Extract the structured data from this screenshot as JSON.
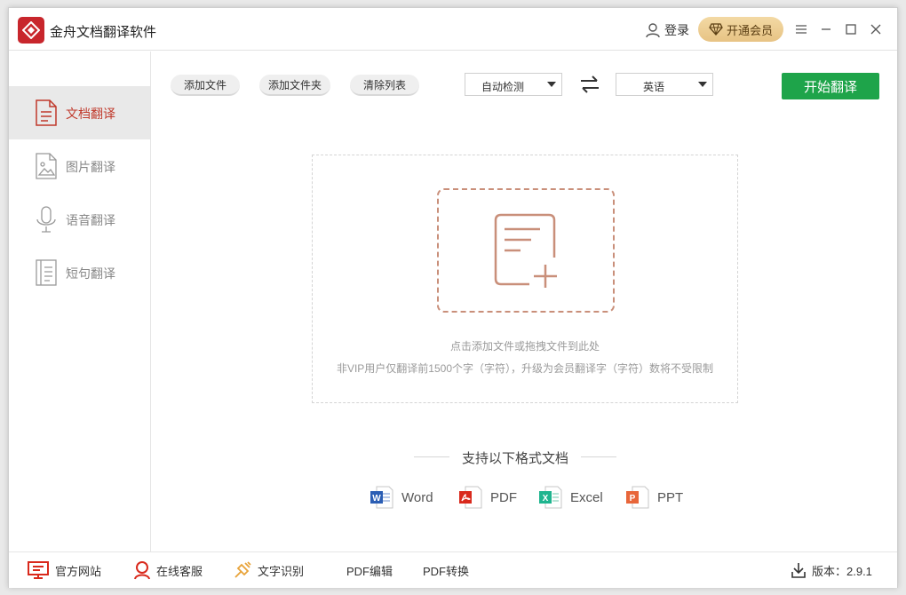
{
  "app": {
    "title": "金舟文档翻译软件",
    "login_label": "登录",
    "vip_label": "开通会员",
    "colors": {
      "brand": "#c8262c",
      "accent_green": "#1ea44a",
      "active_text": "#c0392b",
      "dash": "#c98f7a"
    }
  },
  "sidebar": {
    "items": [
      {
        "label": "文档翻译",
        "icon": "document-icon",
        "active": true
      },
      {
        "label": "图片翻译",
        "icon": "image-icon",
        "active": false
      },
      {
        "label": "语音翻译",
        "icon": "microphone-icon",
        "active": false
      },
      {
        "label": "短句翻译",
        "icon": "text-lines-icon",
        "active": false
      }
    ]
  },
  "toolbar": {
    "add_file": "添加文件",
    "add_folder": "添加文件夹",
    "clear_list": "清除列表",
    "source_lang": "自动检测",
    "target_lang": "英语",
    "start": "开始翻译"
  },
  "dropzone": {
    "hint": "点击添加文件或拖拽文件到此处",
    "note": "非VIP用户仅翻译前1500个字（字符），升级为会员翻译字（字符）数将不受限制"
  },
  "formats": {
    "title": "支持以下格式文档",
    "items": [
      {
        "name": "Word",
        "icon": "word-icon",
        "color": "#2b5eb4"
      },
      {
        "name": "PDF",
        "icon": "pdf-icon",
        "color": "#d9291c"
      },
      {
        "name": "Excel",
        "icon": "excel-icon",
        "color": "#1fb58f"
      },
      {
        "name": "PPT",
        "icon": "ppt-icon",
        "color": "#e8663a"
      }
    ]
  },
  "bottombar": {
    "website": "官方网站",
    "support": "在线客服",
    "ocr": "文字识别",
    "pdf_edit": "PDF编辑",
    "pdf_convert": "PDF转换",
    "version": "版本：2.9.1"
  }
}
